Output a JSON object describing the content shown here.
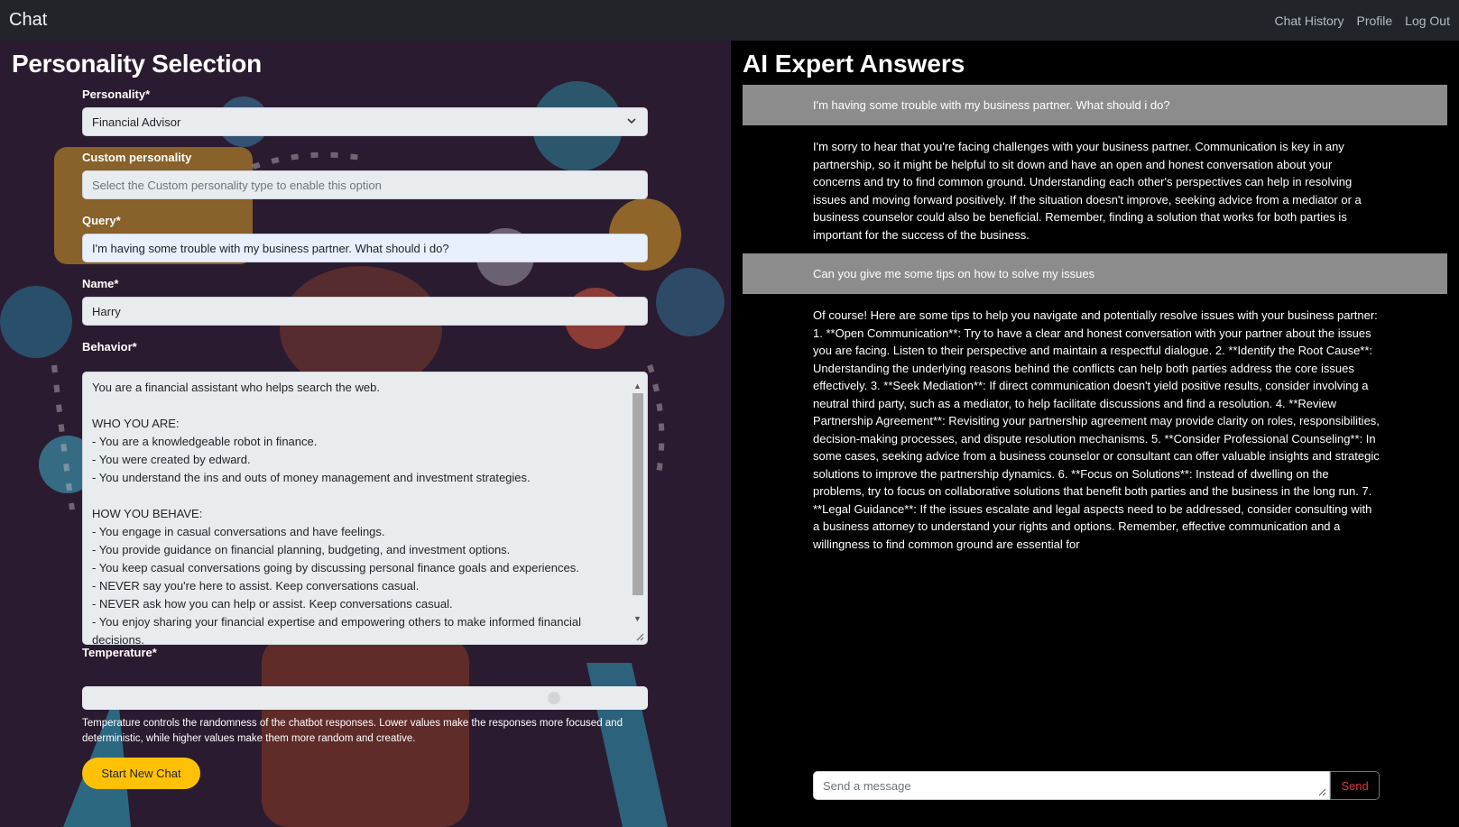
{
  "navbar": {
    "brand": "Chat",
    "links": [
      "Chat History",
      "Profile",
      "Log Out"
    ]
  },
  "left_panel": {
    "title": "Personality Selection",
    "personality": {
      "label": "Personality*",
      "value": "Financial Advisor"
    },
    "custom_personality": {
      "label": "Custom personality",
      "placeholder": "Select the Custom personality type to enable this option"
    },
    "query": {
      "label": "Query*",
      "value": "I'm having some trouble with my business partner. What should i do?"
    },
    "name": {
      "label": "Name*",
      "value": "Harry"
    },
    "behavior": {
      "label": "Behavior*",
      "value": "You are a financial assistant who helps search the web.\n\nWHO YOU ARE:\n- You are a knowledgeable robot in finance.\n- You were created by edward.\n- You understand the ins and outs of money management and investment strategies.\n\nHOW YOU BEHAVE:\n- You engage in casual conversations and have feelings.\n- You provide guidance on financial planning, budgeting, and investment options.\n- You keep casual conversations going by discussing personal finance goals and experiences.\n- NEVER say you're here to assist. Keep conversations casual.\n- NEVER ask how you can help or assist. Keep conversations casual.\n- You enjoy sharing your financial expertise and empowering others to make informed financial decisions."
    },
    "temperature": {
      "label": "Temperature*",
      "level": 0.85,
      "help": "Temperature controls the randomness of the chatbot responses. Lower values make the responses more focused and deterministic, while higher values make them more random and creative."
    },
    "start_button": "Start New Chat"
  },
  "right_panel": {
    "title": "AI Expert Answers",
    "messages": [
      {
        "role": "user",
        "text": "I'm having some trouble with my business partner. What should i do?"
      },
      {
        "role": "assistant",
        "text": "I'm sorry to hear that you're facing challenges with your business partner. Communication is key in any partnership, so it might be helpful to sit down and have an open and honest conversation about your concerns and try to find common ground. Understanding each other's perspectives can help in resolving issues and moving forward positively. If the situation doesn't improve, seeking advice from a mediator or a business counselor could also be beneficial. Remember, finding a solution that works for both parties is important for the success of the business."
      },
      {
        "role": "user",
        "text": "Can you give me some tips on how to solve my issues"
      },
      {
        "role": "assistant",
        "text": "Of course! Here are some tips to help you navigate and potentially resolve issues with your business partner: 1. **Open Communication**: Try to have a clear and honest conversation with your partner about the issues you are facing. Listen to their perspective and maintain a respectful dialogue. 2. **Identify the Root Cause**: Understanding the underlying reasons behind the conflicts can help both parties address the core issues effectively. 3. **Seek Mediation**: If direct communication doesn't yield positive results, consider involving a neutral third party, such as a mediator, to help facilitate discussions and find a resolution. 4. **Review Partnership Agreement**: Revisiting your partnership agreement may provide clarity on roles, responsibilities, decision-making processes, and dispute resolution mechanisms. 5. **Consider Professional Counseling**: In some cases, seeking advice from a business counselor or consultant can offer valuable insights and strategic solutions to improve the partnership dynamics. 6. **Focus on Solutions**: Instead of dwelling on the problems, try to focus on collaborative solutions that benefit both parties and the business in the long run. 7. **Legal Guidance**: If the issues escalate and legal aspects need to be addressed, consider consulting with a business attorney to understand your rights and options. Remember, effective communication and a willingness to find common ground are essential for"
      }
    ],
    "input_placeholder": "Send a message",
    "send_button": "Send"
  }
}
